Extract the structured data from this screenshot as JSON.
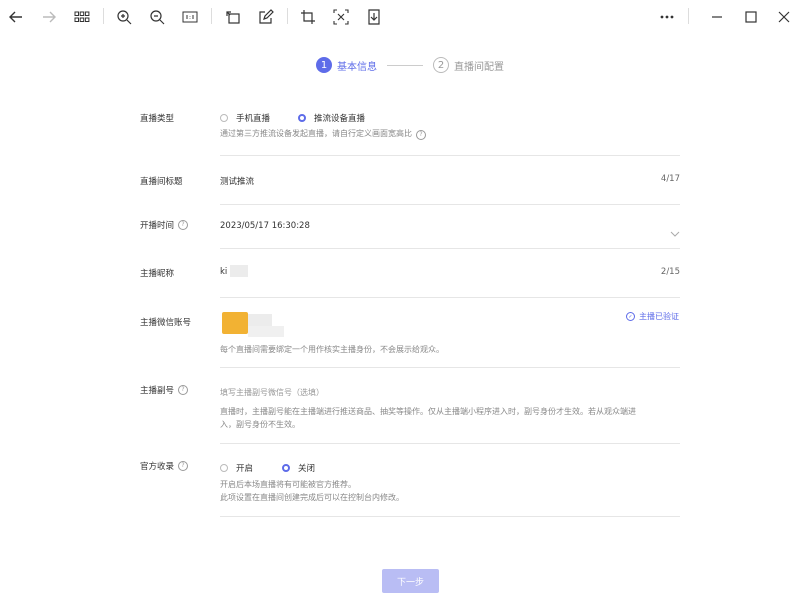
{
  "steps": [
    {
      "number": "1",
      "label": "基本信息"
    },
    {
      "number": "2",
      "label": "直播间配置"
    }
  ],
  "form": {
    "live_type": {
      "label": "直播类型",
      "options": [
        "手机直播",
        "推流设备直播"
      ],
      "selected": "推流设备直播",
      "hint": "通过第三方推流设备发起直播，请自行定义画面宽高比"
    },
    "title": {
      "label": "直播间标题",
      "value": "测试推流",
      "counter": "4/17"
    },
    "start_time": {
      "label": "开播时间",
      "value": "2023/05/17 16:30:28"
    },
    "nickname": {
      "label": "主播昵称",
      "value": "ki",
      "counter": "2/15"
    },
    "wechat": {
      "label": "主播微信账号",
      "verified": "主播已验证",
      "hint": "每个直播间需要绑定一个用作核实主播身份，不会展示给观众。"
    },
    "sub_account": {
      "label": "主播副号",
      "placeholder": "填写主播副号微信号（选填）",
      "hint_line1": "直播时，主播副号能在主播端进行推送商品、抽奖等操作。仅从主播端小程序进入时，副号身份才生效。若从观众端进",
      "hint_line2": "入，副号身份不生效。"
    },
    "official": {
      "label": "官方收录",
      "options": [
        "开启",
        "关闭"
      ],
      "selected": "关闭",
      "hint_line1": "开启后本场直播将有可能被官方推荐。",
      "hint_line2": "此项设置在直播间创建完成后可以在控制台内修改。"
    }
  },
  "next_button": "下一步",
  "colors": {
    "accent": "#5e6ce9",
    "button_disabled": "#b9bdf4"
  }
}
